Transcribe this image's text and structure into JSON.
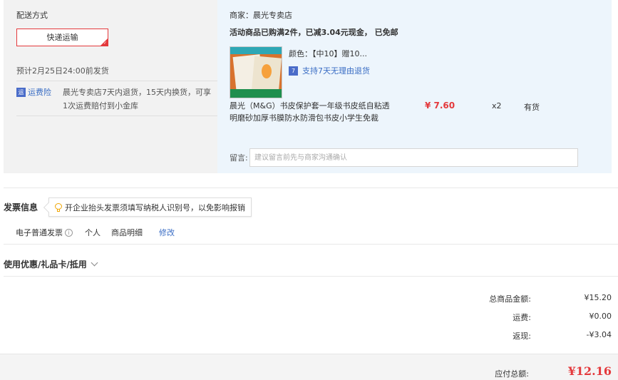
{
  "delivery": {
    "title": "配送方式",
    "method": "快递运输",
    "eta": "预计2月25日24:00前发货",
    "insurance_icon": "运",
    "insurance_label": "运费险",
    "insurance_desc": "晨光专卖店7天内退货，15天内换货，可享1次运费赔付到小金库"
  },
  "order": {
    "shop_name": "商家：晨光专卖店",
    "promo": "活动商品已购满2件，已减3.04元现金， 已免邮",
    "color": "颜色：【中10】赠10...",
    "return_icon": "7",
    "return_policy": "支持7天无理由退货",
    "product_title": "晨光（M&G）书皮保护套一年级书皮纸自粘透明磨砂加厚书膜防水防滑包书皮小学生免裁",
    "price": "¥ 7.60",
    "qty": "x2",
    "stock": "有货",
    "message_label": "留言:",
    "message_placeholder": "建议留言前先与商家沟通确认"
  },
  "invoice": {
    "title": "发票信息",
    "tip": "开企业抬头发票须填写纳税人识别号，以免影响报销",
    "type": "电子普通发票",
    "info_icon": "i",
    "person": "个人",
    "detail": "商品明细",
    "edit": "修改"
  },
  "discount": {
    "title": "使用优惠/礼品卡/抵用"
  },
  "summary": {
    "goods_label": "总商品金额:",
    "goods_value": "¥15.20",
    "shipping_label": "运费:",
    "shipping_value": "¥0.00",
    "cashback_label": "返现:",
    "cashback_value": "-¥3.04",
    "total_label": "应付总额:",
    "total_value": "¥12.16"
  },
  "colors": {
    "accent_red": "#e4393c",
    "link_blue": "#3a6dc4",
    "merchant_bg": "#edf5fc",
    "delivery_bg": "#f2f2f2"
  }
}
